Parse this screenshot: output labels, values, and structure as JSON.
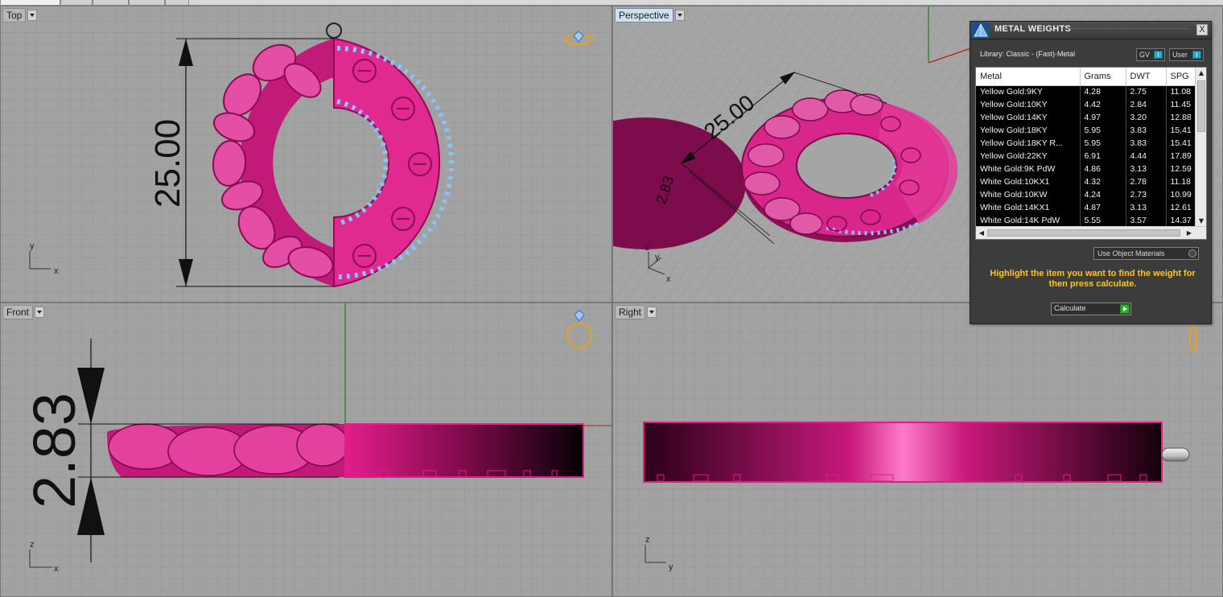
{
  "viewports": {
    "top": {
      "label": "Top",
      "dimension": "25.00",
      "axis_x": "x",
      "axis_y": "y"
    },
    "perspective": {
      "label": "Perspective",
      "dimension_main": "25.00",
      "dimension_height": "2.83",
      "axis_x": "x",
      "axis_y": "y",
      "axis_z": "z"
    },
    "front": {
      "label": "Front",
      "dimension": "2.83",
      "axis_x": "x",
      "axis_z": "z"
    },
    "right": {
      "label": "Right",
      "axis_y": "y",
      "axis_z": "z"
    }
  },
  "metal_weights": {
    "title": "METAL WEIGHTS",
    "close_symbol": "X",
    "library": "Library: Classic - (Fast)-Metal",
    "toggle_gv": "GV",
    "toggle_user": "User",
    "columns": [
      "Metal",
      "Grams",
      "DWT",
      "SPG"
    ],
    "rows": [
      [
        "Yellow Gold:9KY",
        "4.28",
        "2.75",
        "11.08"
      ],
      [
        "Yellow Gold:10KY",
        "4.42",
        "2.84",
        "11.45"
      ],
      [
        "Yellow Gold:14KY",
        "4.97",
        "3.20",
        "12.88"
      ],
      [
        "Yellow Gold:18KY",
        "5.95",
        "3.83",
        "15.41"
      ],
      [
        "Yellow Gold:18KY R...",
        "5.95",
        "3.83",
        "15.41"
      ],
      [
        "Yellow Gold:22KY",
        "6.91",
        "4.44",
        "17.89"
      ],
      [
        "White Gold:9K PdW",
        "4.86",
        "3.13",
        "12.59"
      ],
      [
        "White Gold:10KX1",
        "4.32",
        "2.78",
        "11.18"
      ],
      [
        "White Gold:10KW",
        "4.24",
        "2.73",
        "10.99"
      ],
      [
        "White Gold:14KX1",
        "4.87",
        "3.13",
        "12.61"
      ],
      [
        "White Gold:14K PdW",
        "5.55",
        "3.57",
        "14.37"
      ]
    ],
    "use_object_materials": "Use Object Materials",
    "hint": "Highlight the item you want to find the weight for then press calculate.",
    "calculate": "Calculate"
  },
  "colors": {
    "viewport_bg": "#a2a2a2",
    "grid_line": "#8d8d8d",
    "model_pink": "#e0248e",
    "model_dark": "#9b1060",
    "stone_blue": "#8fc8ff",
    "accent_yellow": "#ffc421",
    "axis_red": "#b62020",
    "axis_green": "#1d8a1d"
  },
  "icons": [
    "ring-view-icon",
    "metal-weights-logo-icon",
    "close-icon",
    "calculate-go-icon",
    "cursor-icon"
  ]
}
